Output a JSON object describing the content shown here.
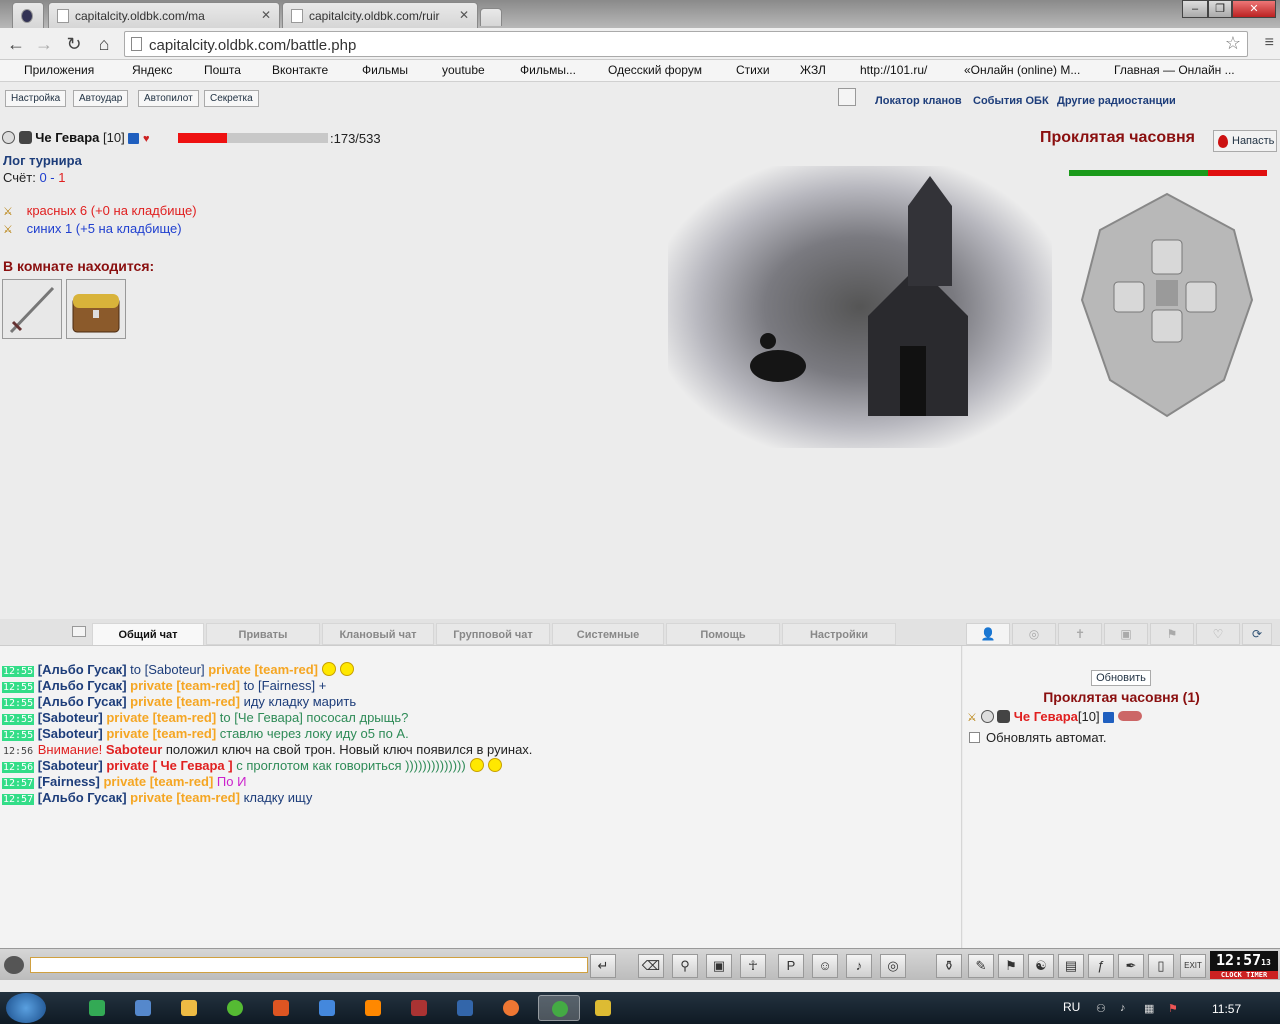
{
  "browser": {
    "tabs": [
      {
        "label": "capitalcity.oldbk.com/ma"
      },
      {
        "label": "capitalcity.oldbk.com/ruir"
      }
    ],
    "address": "capitalcity.oldbk.com/battle.php",
    "bookmarks": [
      {
        "label": "Приложения",
        "color": "#c22"
      },
      {
        "label": "Яндекс",
        "color": "#888"
      },
      {
        "label": "Пошта",
        "color": "#888"
      },
      {
        "label": "Вконтакте",
        "color": "#4a6ea9"
      },
      {
        "label": "Фильмы",
        "color": "#666"
      },
      {
        "label": "youtube",
        "color": "#e00"
      },
      {
        "label": "Фильмы...",
        "color": "#5a3"
      },
      {
        "label": "Одесский форум",
        "color": "#38c"
      },
      {
        "label": "Стихи",
        "color": "#e60"
      },
      {
        "label": "ЖЗЛ",
        "color": "#c00"
      },
      {
        "label": "http://101.ru/",
        "color": "#444"
      },
      {
        "label": "«Онлайн (online) М...",
        "color": "#7a5"
      },
      {
        "label": "Главная — Онлайн ...",
        "color": "#2aa"
      }
    ]
  },
  "game": {
    "top_buttons": [
      "Настройка",
      "Автоудар",
      "Автопилот",
      "Секретка"
    ],
    "top_links": [
      "Локатор кланов",
      "События ОБК",
      "Другие радиостанции"
    ],
    "character": {
      "name": "Че Гевара",
      "level": "[10]",
      "hp_current": 173,
      "hp_max": 533,
      "hp_text": ":173/533",
      "hp_fraction": 0.325
    },
    "log_title": "Лог турнира",
    "score_label": "Счёт:",
    "score_blue": "0",
    "score_dash": "-",
    "score_red": "1",
    "team_red": "красных 6 (+0 на кладбище)",
    "team_blue": "синих 1 (+5 на кладбище)",
    "room_header": "В комнате находится:",
    "location_name": "Проклятая часовня",
    "attack_button": "Напасть",
    "team_balance": {
      "green": 0.7,
      "red": 0.3
    },
    "colors": {
      "accent_red": "#8a0f0f",
      "link_blue": "#1d3d7a",
      "private_orange": "#f5a623"
    }
  },
  "chat_tabs": [
    "Общий чат",
    "Приваты",
    "Клановый чат",
    "Групповой чат",
    "Системные",
    "Помощь",
    "Настройки"
  ],
  "chat": [
    {
      "time": "12:55",
      "parts": [
        [
          "nick",
          "[Альбо Гусак]"
        ],
        [
          "txt",
          " to [Saboteur] "
        ],
        [
          "priv",
          "private [team-red]"
        ]
      ],
      "smiles": 2
    },
    {
      "time": "12:55",
      "parts": [
        [
          "nick",
          "[Альбо Гусак]"
        ],
        [
          "priv",
          " private [team-red]"
        ],
        [
          "txt",
          " to [Fairness] +"
        ]
      ],
      "smiles": 0
    },
    {
      "time": "12:55",
      "parts": [
        [
          "nick",
          "[Альбо Гусак]"
        ],
        [
          "priv",
          " private [team-red]"
        ],
        [
          "txt",
          " иду кладку марить"
        ]
      ],
      "smiles": 0
    },
    {
      "time": "12:55",
      "parts": [
        [
          "nick",
          "[Saboteur]"
        ],
        [
          "priv",
          " private [team-red]"
        ],
        [
          "green",
          " to [Че Гевара] пососал дрыщь?"
        ]
      ],
      "smiles": 0
    },
    {
      "time": "12:55",
      "parts": [
        [
          "nick",
          "[Saboteur]"
        ],
        [
          "priv",
          " private [team-red]"
        ],
        [
          "green",
          " ставлю через локу иду о5 по А."
        ]
      ],
      "smiles": 0
    },
    {
      "time": "12:56",
      "plain": true,
      "parts": [
        [
          "warn",
          "Внимание! "
        ],
        [
          "warnb",
          "Saboteur"
        ],
        [
          "sys",
          " положил ключ на свой трон. Новый ключ появился в руинах."
        ]
      ],
      "smiles": 0
    },
    {
      "time": "12:56",
      "parts": [
        [
          "nick",
          "[Saboteur]"
        ],
        [
          "privme",
          " private [ Че Гевара ]"
        ],
        [
          "green",
          " с проглотом как говориться ))))))))))))))"
        ]
      ],
      "smiles": 2
    },
    {
      "time": "12:57",
      "parts": [
        [
          "nick",
          "[Fairness]"
        ],
        [
          "priv",
          " private [team-red]"
        ],
        [
          "pink",
          " По И"
        ]
      ],
      "smiles": 0
    },
    {
      "time": "12:57",
      "parts": [
        [
          "nick",
          "[Альбо Гусак]"
        ],
        [
          "priv",
          " private [team-red]"
        ],
        [
          "txt",
          " кладку ищу"
        ]
      ],
      "smiles": 0
    }
  ],
  "right_panel": {
    "refresh_button": "Обновить",
    "room_title": "Проклятая часовня (1)",
    "user_name": "Че Гевара",
    "user_level": "[10]",
    "auto_refresh_label": "Обновлять автомат.",
    "auto_refresh_checked": false
  },
  "bottom_bar": {
    "input_value": "",
    "clock_time": "12:57",
    "clock_seconds": "13",
    "clock_label": "CLOCK TIMER"
  },
  "taskbar": {
    "language": "RU",
    "time": "11:57"
  }
}
